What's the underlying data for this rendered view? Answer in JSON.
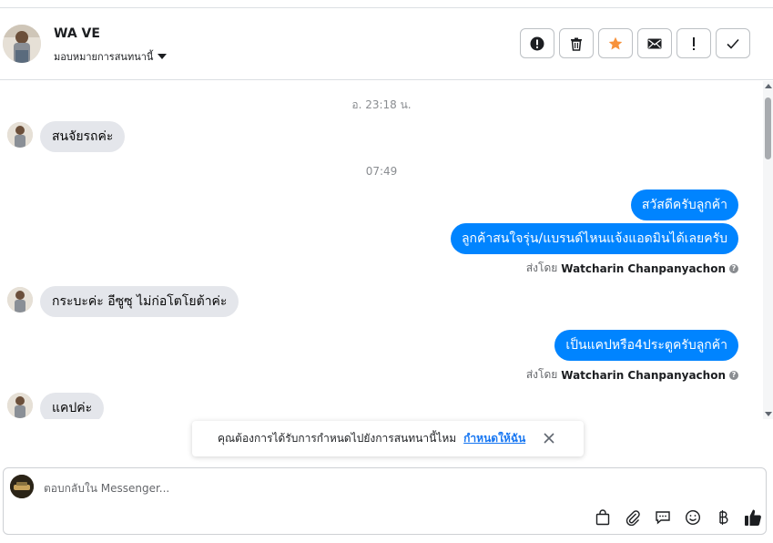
{
  "header": {
    "contact_name": "WA VE",
    "assign_label": "มอบหมายการสนทนานี้",
    "actions": [
      {
        "name": "spam-button",
        "icon": "alert-circle-icon"
      },
      {
        "name": "delete-button",
        "icon": "trash-icon"
      },
      {
        "name": "star-button",
        "icon": "star-icon",
        "color": "#f7923b"
      },
      {
        "name": "mark-unread-button",
        "icon": "envelope-icon"
      },
      {
        "name": "follow-up-button",
        "icon": "exclamation-icon"
      },
      {
        "name": "mark-done-button",
        "icon": "check-icon"
      }
    ]
  },
  "chat": {
    "timestamps": [
      "อ. 23:18 น.",
      "07:49"
    ],
    "incoming": [
      "สนจัยรถค่ะ",
      "กระบะค่ะ อีซูซุ ไม่ก่อโตโยต้าค่ะ",
      "แคปค่ะ"
    ],
    "outgoing": [
      "สวัสดีครับลูกค้า",
      "ลูกค้าสนใจรุ่น/แบรนด์ไหนแจ้งแอดมินได้เลยครับ",
      "เป็นแคปหรือ4ประตูครับลูกค้า"
    ],
    "sent_by_prefix": "ส่งโดย",
    "sent_by_name": "Watcharin Chanpanyachon",
    "bubble_color": "#0084ff"
  },
  "toast": {
    "text": "คุณต้องการได้รับการกำหนดไปยังการสนทนานี้ไหม",
    "link": "กำหนดให้ฉัน"
  },
  "composer": {
    "placeholder": "ตอบกลับใน Messenger...",
    "tools": [
      "shopping-bag-icon",
      "paperclip-icon",
      "speech-bubble-icon",
      "smiley-icon",
      "baht-icon",
      "thumbs-up-icon"
    ]
  }
}
